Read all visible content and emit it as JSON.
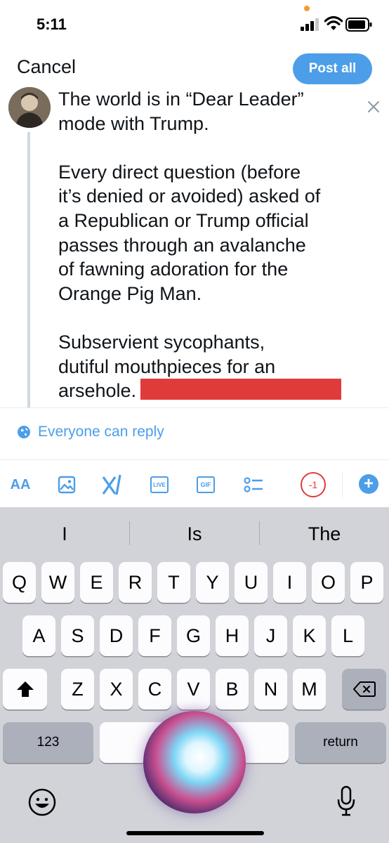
{
  "status_bar": {
    "time": "5:11"
  },
  "header": {
    "cancel_label": "Cancel",
    "post_all_label": "Post all"
  },
  "composer": {
    "text_line1": "The world is in “Dear Leader”\nmode with Trump.\n\nEvery direct question (before\nit’s denied or avoided) asked of\na Republican or Trump official\npasses through an avalanche\nof fawning adoration for the\nOrange Pig Man.\n\nSubservient sycophants,\ndutiful mouthpieces for an\narsehole.",
    "reply_setting": "Everyone can reply"
  },
  "toolbar": {
    "text_style_label": "AA",
    "live_label": "LIVE",
    "gif_label": "GIF",
    "char_counter": "-1"
  },
  "keyboard": {
    "suggestions": [
      "I",
      "Is",
      "The"
    ],
    "row1": [
      "Q",
      "W",
      "E",
      "R",
      "T",
      "Y",
      "U",
      "I",
      "O",
      "P"
    ],
    "row2": [
      "A",
      "S",
      "D",
      "F",
      "G",
      "H",
      "J",
      "K",
      "L"
    ],
    "row3": [
      "Z",
      "X",
      "C",
      "V",
      "B",
      "N",
      "M"
    ],
    "numbers_label": "123",
    "return_label": "return"
  },
  "colors": {
    "accent": "#4c9ee8",
    "warning": "#e03b3b",
    "keyboard_bg": "#d1d3d9"
  },
  "icons": [
    "signal-icon",
    "wifi-icon",
    "battery-icon",
    "close-icon",
    "globe-icon",
    "image-icon",
    "grok-icon",
    "live-icon",
    "gif-icon",
    "poll-icon",
    "plus-icon",
    "shift-icon",
    "backspace-icon",
    "emoji-icon",
    "mic-icon",
    "siri-orb"
  ]
}
